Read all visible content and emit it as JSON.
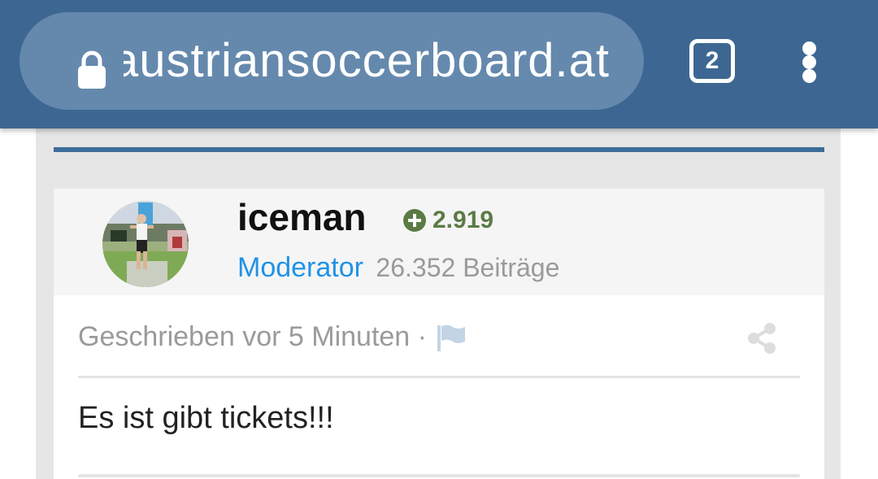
{
  "browser": {
    "url": "austriansoccerboard.at",
    "tab_count": "2",
    "icons": {
      "lock": "lock-icon",
      "menu": "more-vert-icon"
    }
  },
  "post": {
    "author": {
      "username": "iceman",
      "reputation": "2.919",
      "role": "Moderator",
      "post_count": "26.352 Beiträge"
    },
    "meta": {
      "written": "Geschrieben vor 5 Minuten ·"
    },
    "content": "Es ist gibt tickets!!!"
  },
  "colors": {
    "toolbar": "#3d6792",
    "url_pill": "#6589ad",
    "accent_line": "#3d6d99",
    "reputation": "#5b7b45",
    "role": "#1f93e6",
    "muted_text": "#9a9a9a"
  }
}
